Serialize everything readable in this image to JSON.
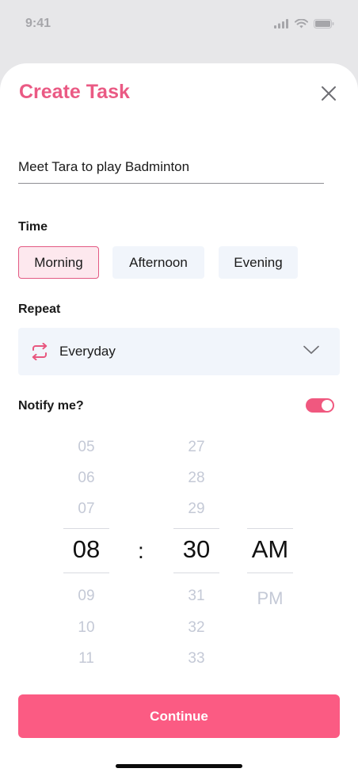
{
  "status_bar": {
    "time": "9:41"
  },
  "header": {
    "title": "Create Task"
  },
  "task": {
    "value": "Meet Tara to play Badminton"
  },
  "time_section": {
    "label": "Time",
    "options": [
      "Morning",
      "Afternoon",
      "Evening"
    ],
    "selected": "Morning"
  },
  "repeat_section": {
    "label": "Repeat",
    "value": "Everyday"
  },
  "notify": {
    "label": "Notify me?",
    "enabled": true
  },
  "picker": {
    "hours": [
      "05",
      "06",
      "07",
      "08",
      "09",
      "10",
      "11"
    ],
    "selected_hour": "08",
    "separator": ":",
    "minutes": [
      "27",
      "28",
      "29",
      "30",
      "31",
      "32",
      "33"
    ],
    "selected_minute": "30",
    "periods": [
      "AM",
      "PM"
    ],
    "selected_period": "AM"
  },
  "footer": {
    "continue_label": "Continue"
  },
  "colors": {
    "accent": "#fb5b83",
    "title": "#ea5a84",
    "chip_bg": "#f1f5fb",
    "chip_active_bg": "#fde8ee"
  }
}
